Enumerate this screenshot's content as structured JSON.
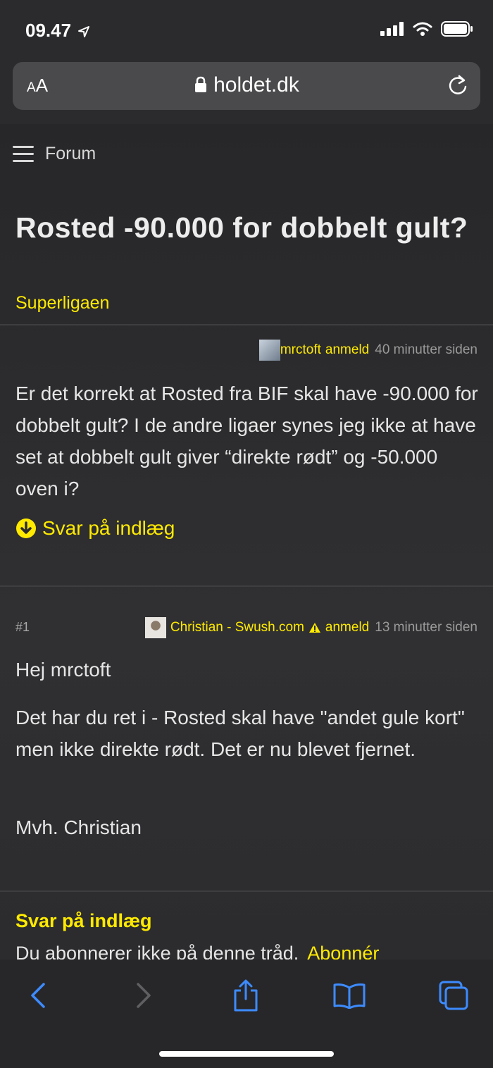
{
  "status_bar": {
    "time": "09.47"
  },
  "address_bar": {
    "aa_small": "A",
    "aa_large": "A",
    "url": "holdet.dk"
  },
  "nav": {
    "forum_label": "Forum"
  },
  "thread": {
    "title": "Rosted -90.000 for dobbelt gult?",
    "category": "Superligaen"
  },
  "posts": [
    {
      "number": "",
      "author": "mrctoft",
      "report_label": "anmeld",
      "time": "40 minutter siden",
      "paragraphs": [
        "Er det korrekt at Rosted fra BIF skal have -90.000 for dobbelt gult? I de andre ligaer synes jeg ikke at have set at dobbelt gult giver “direkte rødt” og -50.000 oven i?"
      ],
      "reply_label": "Svar på indlæg"
    },
    {
      "number": "#1",
      "author": "Christian - Swush.com",
      "report_label": "anmeld",
      "time": "13 minutter siden",
      "paragraphs": [
        "Hej mrctoft",
        "Det har du ret i - Rosted skal have \"andet gule kort\" men ikke direkte rødt. Det er nu blevet fjernet.",
        "Mvh. Christian"
      ]
    }
  ],
  "reply_section": {
    "heading": "Svar på indlæg",
    "subscription_text": "Du abonnerer ikke på denne tråd.",
    "subscribe_link": "Abonnér"
  },
  "colors": {
    "accent": "#ffea00",
    "toolbar_icons": "#3d8bff",
    "background": "#2b2b2d"
  },
  "icons": [
    "location-arrow-icon",
    "signal-icon",
    "wifi-icon",
    "battery-icon",
    "lock-icon",
    "reload-icon",
    "hamburger-menu-icon",
    "arrow-down-circle-icon",
    "warning-icon",
    "back-icon",
    "forward-icon",
    "share-icon",
    "bookmarks-icon",
    "tabs-icon"
  ]
}
